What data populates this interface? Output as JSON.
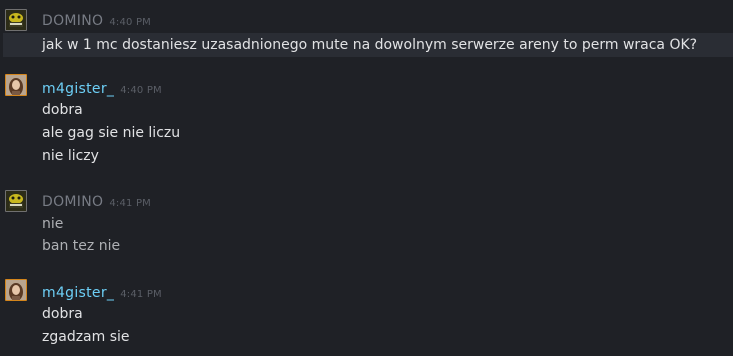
{
  "colors": {
    "background": "#1f2126",
    "name_domino": "#777b84",
    "name_m4gister": "#6dcff6",
    "timestamp": "#5a5e66",
    "message_text": "#e1e2e4",
    "message_dim": "#aeb0b4"
  },
  "messages": [
    {
      "author": "DOMINO",
      "time": "4:40 PM",
      "avatar": "domino-avatar-icon",
      "lines": [
        "jak w 1 mc dostaniesz uzasadnionego mute na dowolnym serwerze areny to perm wraca OK?"
      ]
    },
    {
      "author": "m4gister_",
      "time": "4:40 PM",
      "avatar": "m4gister-avatar-icon",
      "lines": [
        "dobra",
        "ale gag sie nie liczu",
        "nie liczy"
      ]
    },
    {
      "author": "DOMINO",
      "time": "4:41 PM",
      "avatar": "domino-avatar-icon",
      "lines": [
        "nie",
        "ban tez nie"
      ]
    },
    {
      "author": "m4gister_",
      "time": "4:41 PM",
      "avatar": "m4gister-avatar-icon",
      "lines": [
        "dobra",
        "zgadzam sie"
      ]
    }
  ]
}
